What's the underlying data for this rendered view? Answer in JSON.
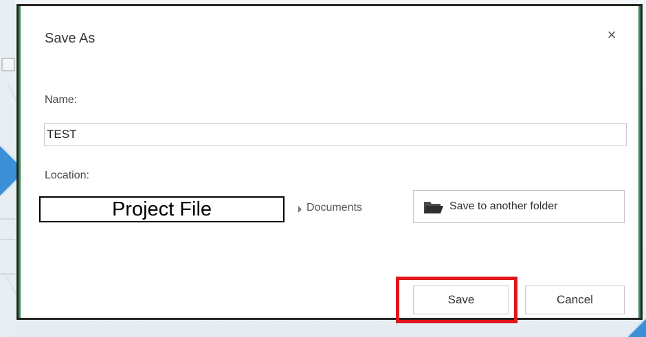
{
  "dialog": {
    "title": "Save As",
    "close_glyph": "×"
  },
  "name": {
    "label": "Name:",
    "value": "TEST"
  },
  "location": {
    "label": "Location:",
    "current": "Project File",
    "breadcrumb": "Documents"
  },
  "buttons": {
    "another_folder": "Save to another folder",
    "save": "Save",
    "cancel": "Cancel"
  },
  "icons": {
    "close": "close-icon",
    "folder": "folder-icon",
    "breadcrumb_arrow": "chevron-right-icon"
  },
  "colors": {
    "highlight": "#e0161b",
    "dialog_border": "#222222",
    "accent_edge": "#3c8f5a",
    "background_arrow": "#3a8fd6"
  }
}
